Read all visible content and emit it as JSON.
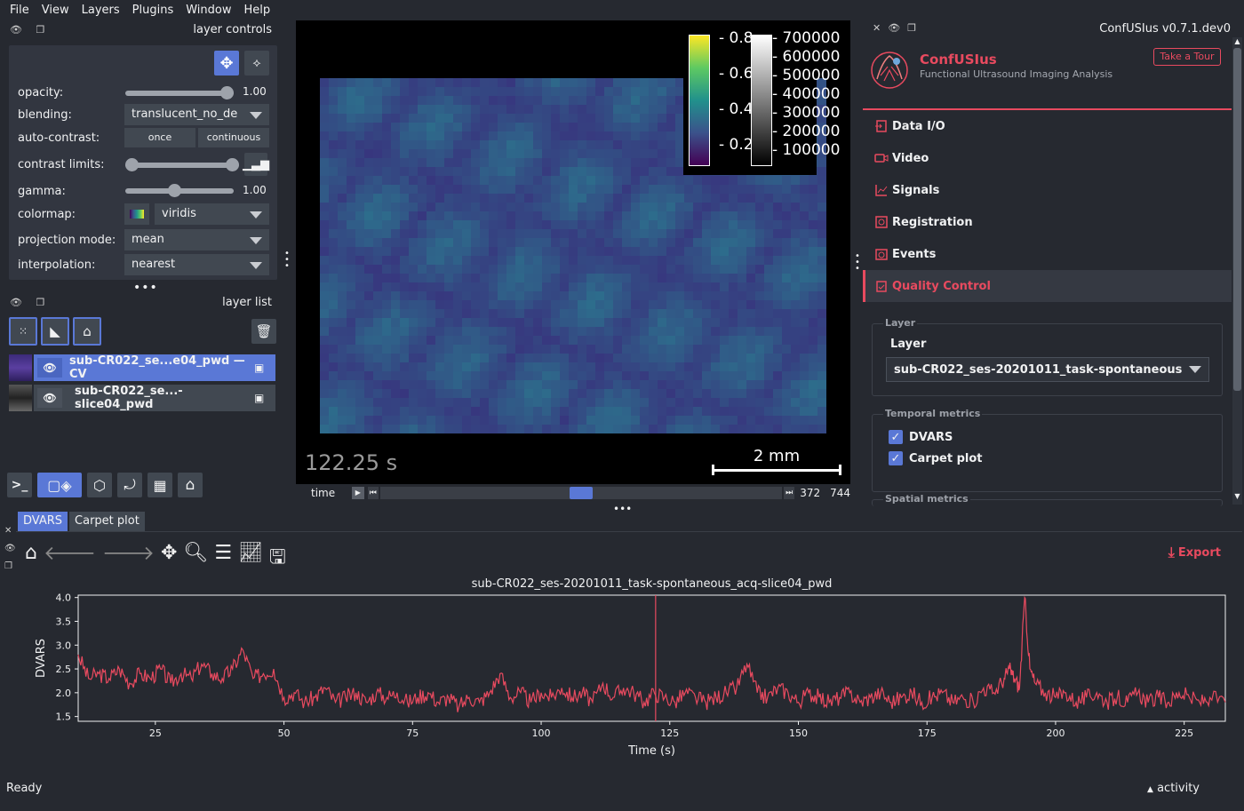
{
  "menu": [
    "File",
    "View",
    "Layers",
    "Plugins",
    "Window",
    "Help"
  ],
  "layer_controls": {
    "title": "layer controls",
    "opacity": {
      "label": "opacity:",
      "value": "1.00",
      "level": 1.0
    },
    "blending": {
      "label": "blending:",
      "value": "translucent_no_de"
    },
    "auto_contrast": {
      "label": "auto-contrast:",
      "once": "once",
      "continuous": "continuous"
    },
    "contrast": {
      "label": "contrast limits:"
    },
    "gamma": {
      "label": "gamma:",
      "value": "1.00",
      "level": 0.45
    },
    "colormap": {
      "label": "colormap:",
      "value": "viridis"
    },
    "projection": {
      "label": "projection mode:",
      "value": "mean"
    },
    "interpolation": {
      "label": "interpolation:",
      "value": "nearest"
    }
  },
  "layer_list": {
    "title": "layer list",
    "items": [
      {
        "name": "sub-CR022_se...e04_pwd — CV",
        "selected": true
      },
      {
        "name": "sub-CR022_se...-slice04_pwd",
        "selected": false
      }
    ]
  },
  "viewer": {
    "colorbar1": [
      "0.8",
      "0.6",
      "0.4",
      "0.2"
    ],
    "colorbar2": [
      "700000",
      "600000",
      "500000",
      "400000",
      "300000",
      "200000",
      "100000"
    ],
    "time_text": "122.25 s",
    "scale_text": "2 mm",
    "slider_label": "time",
    "current_frame": "372",
    "total_frames": "744"
  },
  "plugin": {
    "title": "ConfUSIus v0.7.1.dev0",
    "brand": "ConfUSIus",
    "subtitle": "Functional Ultrasound Imaging Analysis",
    "tour_button": "Take a Tour",
    "nav": [
      "Data I/O",
      "Video",
      "Signals",
      "Registration",
      "Events",
      "Quality Control"
    ],
    "active_nav": "Quality Control",
    "layer_group": "Layer",
    "layer_label": "Layer",
    "layer_value": "sub-CR022_ses-20201011_task-spontaneous",
    "temporal_group": "Temporal metrics",
    "dvars_label": "DVARS",
    "carpet_label": "Carpet plot",
    "spatial_group": "Spatial metrics",
    "accent": "#e84a5f"
  },
  "bottom": {
    "tabs": [
      "DVARS",
      "Carpet plot"
    ],
    "export": "Export"
  },
  "chart_data": {
    "type": "line",
    "title": "sub-CR022_ses-20201011_task-spontaneous_acq-slice04_pwd",
    "xlabel": "Time (s)",
    "ylabel": "DVARS",
    "xlim": [
      10,
      233
    ],
    "ylim": [
      1.4,
      4.05
    ],
    "xticks": [
      25,
      50,
      75,
      100,
      125,
      150,
      175,
      200,
      225
    ],
    "yticks": [
      1.5,
      2.0,
      2.5,
      3.0,
      3.5,
      4.0
    ],
    "cursor_x": 122.25,
    "series": [
      {
        "color": "#e84a5f",
        "x": [
          10,
          12,
          14,
          16,
          18,
          20,
          22,
          24,
          26,
          28,
          30,
          32,
          34,
          36,
          38,
          40,
          42,
          44,
          46,
          48,
          50,
          52,
          54,
          56,
          58,
          60,
          62,
          64,
          66,
          68,
          70,
          72,
          74,
          76,
          78,
          80,
          82,
          84,
          86,
          88,
          90,
          92,
          94,
          96,
          98,
          100,
          102,
          104,
          106,
          108,
          110,
          112,
          114,
          116,
          118,
          120,
          122,
          124,
          126,
          128,
          130,
          132,
          134,
          136,
          138,
          140,
          142,
          144,
          146,
          148,
          150,
          152,
          154,
          156,
          158,
          160,
          162,
          164,
          166,
          168,
          170,
          172,
          174,
          176,
          178,
          180,
          182,
          184,
          186,
          188,
          190,
          191,
          192,
          193,
          194,
          195,
          196,
          198,
          200,
          202,
          204,
          206,
          208,
          210,
          212,
          214,
          216,
          218,
          220,
          222,
          224,
          226,
          228,
          230,
          233
        ],
        "y": [
          2.8,
          2.3,
          2.4,
          2.3,
          2.5,
          2.2,
          2.4,
          2.3,
          2.5,
          2.2,
          2.4,
          2.3,
          2.6,
          2.4,
          2.3,
          2.5,
          2.9,
          2.3,
          2.4,
          2.5,
          1.9,
          2.0,
          1.8,
          1.9,
          2.1,
          1.8,
          1.9,
          2.0,
          1.8,
          2.0,
          1.9,
          2.0,
          1.8,
          1.9,
          2.0,
          1.8,
          1.9,
          1.7,
          1.9,
          1.8,
          2.0,
          2.4,
          1.9,
          2.0,
          1.8,
          2.0,
          1.9,
          2.1,
          1.9,
          2.0,
          1.8,
          2.2,
          1.9,
          2.1,
          2.0,
          1.8,
          2.0,
          1.9,
          1.8,
          2.0,
          1.9,
          1.8,
          1.9,
          2.0,
          2.1,
          2.6,
          2.0,
          1.9,
          2.1,
          2.0,
          1.8,
          2.0,
          1.9,
          1.8,
          1.9,
          2.0,
          1.8,
          1.9,
          2.0,
          1.8,
          1.9,
          2.0,
          1.8,
          1.9,
          2.0,
          1.8,
          1.9,
          1.8,
          2.1,
          2.0,
          2.3,
          2.5,
          2.3,
          2.1,
          4.0,
          2.5,
          2.2,
          2.0,
          1.9,
          2.0,
          1.8,
          1.9,
          2.0,
          1.8,
          1.9,
          1.8,
          2.0,
          1.8,
          1.9,
          1.8,
          2.0,
          1.9,
          1.8,
          1.9,
          1.8
        ]
      }
    ]
  },
  "status": {
    "left": "Ready",
    "right": "activity"
  }
}
